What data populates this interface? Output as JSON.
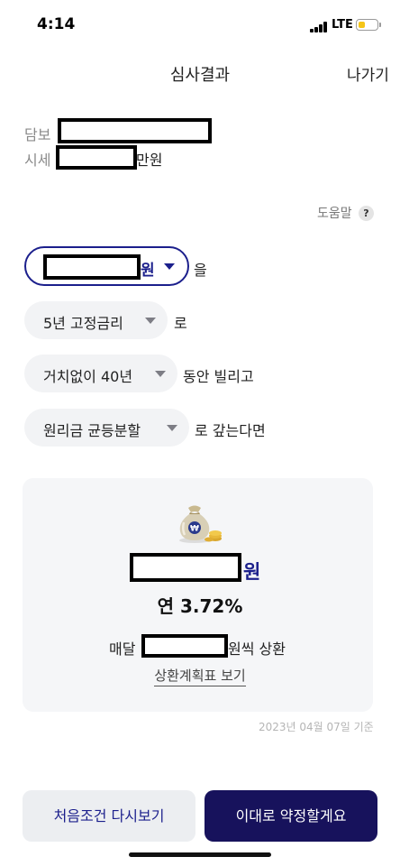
{
  "status_bar": {
    "time": "4:14",
    "network": "LTE",
    "battery_level": 0.4,
    "battery_color": "#f5c518"
  },
  "header": {
    "title": "심사결과",
    "exit_label": "나가기"
  },
  "collateral": {
    "label_line1": "담보",
    "label_line2": "시세",
    "price_unit": "만원"
  },
  "help": {
    "label": "도움말",
    "icon_glyph": "?"
  },
  "selectors": {
    "amount_unit": "원",
    "amount_suffix": "을",
    "rate_type": "5년 고정금리",
    "rate_suffix": "로",
    "term": "거치없이 40년",
    "term_suffix": "동안 빌리고",
    "repayment": "원리금 균등분할",
    "repayment_suffix": "로 갚는다면"
  },
  "result": {
    "icon": "money-bag-icon",
    "amount_unit": "원",
    "rate": "연 3.72%",
    "monthly_prefix": "매달",
    "monthly_suffix": "원씩 상환",
    "schedule_link": "상환계획표 보기"
  },
  "as_of_date": "2023년 04월 07일 기준",
  "buttons": {
    "reset": "처음조건 다시보기",
    "agree": "이대로 약정할게요"
  },
  "colors": {
    "accent": "#1b1f8c",
    "primary_button": "#17125c"
  }
}
